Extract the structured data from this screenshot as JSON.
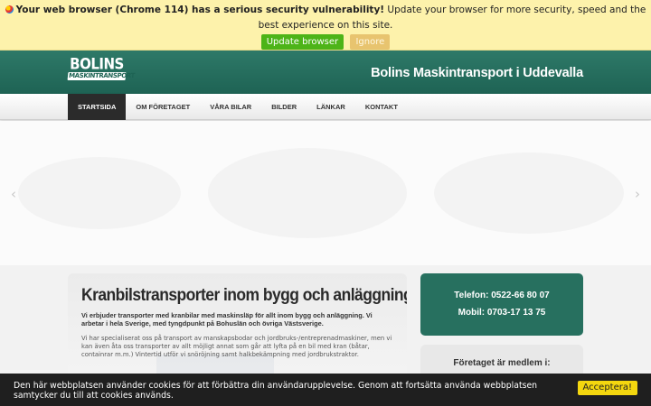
{
  "update_bar": {
    "bold_text": "Your web browser (Chrome 114) has a serious security vulnerability!",
    "text": " Update your browser for more security, speed and the best experience on this site.",
    "update_label": "Update browser",
    "ignore_label": "Ignore"
  },
  "header": {
    "logo_line1": "BOLINS",
    "logo_line2": "MASKINTRANSPORT",
    "title": "Bolins Maskintransport i Uddevalla",
    "brand_color": "#27705f"
  },
  "nav": {
    "items": [
      {
        "label": "STARTSIDA",
        "active": true
      },
      {
        "label": "OM FÖRETAGET",
        "active": false
      },
      {
        "label": "VÅRA BILAR",
        "active": false
      },
      {
        "label": "BILDER",
        "active": false
      },
      {
        "label": "LÄNKAR",
        "active": false
      },
      {
        "label": "KONTAKT",
        "active": false
      }
    ]
  },
  "slider": {
    "prev_arrow": "‹",
    "next_arrow": "›"
  },
  "content": {
    "heading": "Kranbilstransporter inom bygg och anläggning",
    "lead": "Vi erbjuder transporter med kranbilar med maskinsläp för allt inom bygg och anläggning. Vi arbetar i hela Sverige, med tyngdpunkt på Bohuslän och övriga Västsverige.",
    "body": "Vi har specialiserat oss på transport av manskapsbodar och jordbruks-/entreprenadmaskiner, men vi kan även åta oss transporter av allt möjligt annat som går att lyfta på en bil med kran (båtar, containrar m.m.) Vintertid utför vi snöröjning samt halkbekämpning med jordbrukstraktor."
  },
  "contact": {
    "phone": "Telefon: 0522-66 80 07",
    "mobile": "Mobil: 0703-17 13 75"
  },
  "member": {
    "heading": "Företaget är medlem i:"
  },
  "cookie": {
    "text": "Den här webbplatsen använder cookies för att förbättra din användarupplevelse. Genom att fortsätta använda webbplatsen samtycker du till att cookies används.",
    "accept_label": "Acceptera!"
  }
}
